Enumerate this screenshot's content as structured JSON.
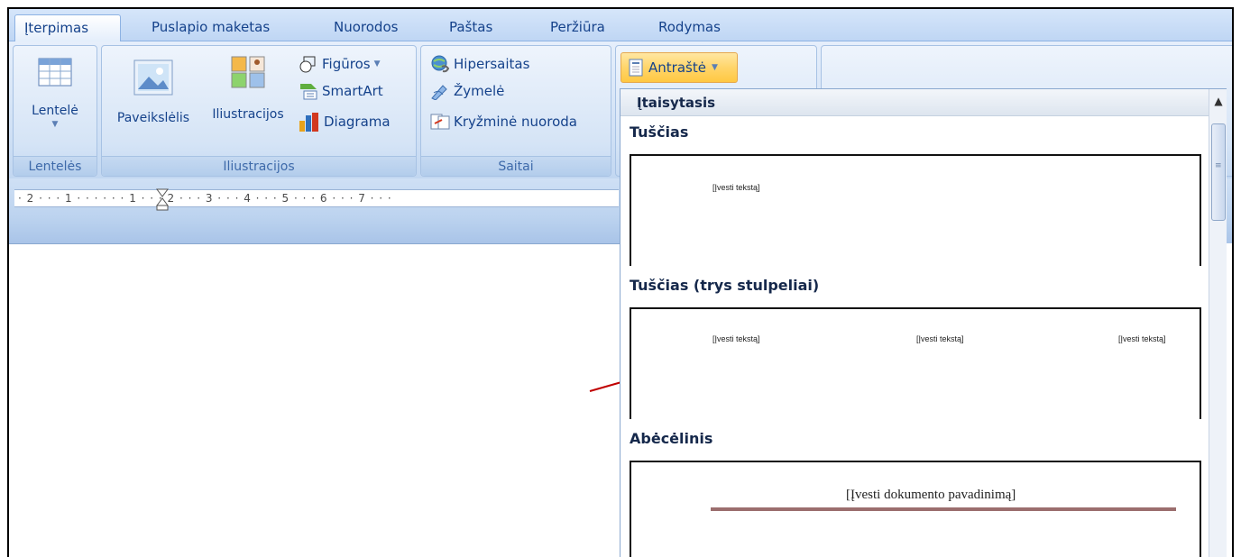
{
  "tabs": [
    "Įterpimas",
    "Puslapio maketas",
    "Nuorodos",
    "Paštas",
    "Peržiūra",
    "Rodymas"
  ],
  "ribbon": {
    "tables_group": {
      "button_label": "Lentelė",
      "group_label": "Lentelės"
    },
    "illustrations_group": {
      "picture_label": "Paveikslėlis",
      "clipart_label": "Iliustracijos",
      "shapes_label": "Figūros",
      "smartart_label": "SmartArt",
      "chart_label": "Diagrama",
      "group_label": "Iliustracijos"
    },
    "links_group": {
      "hyperlink_label": "Hipersaitas",
      "bookmark_label": "Žymelė",
      "crossref_label": "Kryžminė nuoroda",
      "group_label": "Saitai"
    },
    "header_button_label": "Antraštė"
  },
  "ruler": {
    "text": "· 2 · · · 1 · · ·    · · · 1 · · · 2 · · · 3 · · · 4 · · · 5 · · · 6 · · · 7 · · ·"
  },
  "gallery": {
    "header": "Įtaisytasis",
    "sections": [
      {
        "title": "Tuščias",
        "placeholders": [
          "[Įvesti tekstą]"
        ]
      },
      {
        "title": "Tuščias (trys stulpeliai)",
        "placeholders": [
          "[Įvesti tekstą]",
          "[Įvesti tekstą]",
          "[Įvesti tekstą]"
        ]
      },
      {
        "title": "Abėcėlinis",
        "placeholders": [
          "[Įvesti dokumento pavadinimą]"
        ]
      }
    ]
  },
  "colors": {
    "ribbon_text": "#15428b",
    "arrow": "#c00000",
    "title_rule": "#9b6e6e"
  }
}
